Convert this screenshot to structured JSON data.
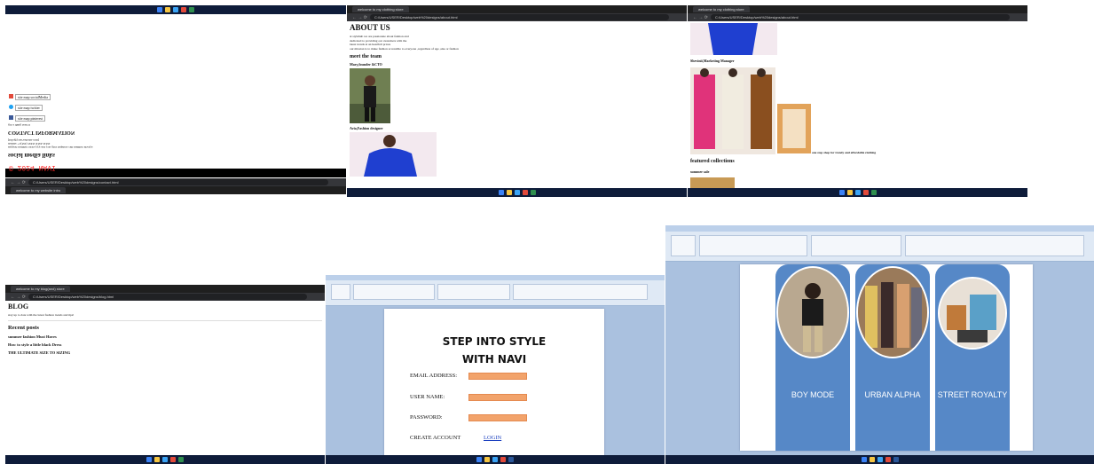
{
  "shot1": {
    "tab_title": "welcome to my website intro",
    "url": "C:/Users/USER/Desktop/web%20designs/contact.html",
    "socials": [
      "site map socialMedia",
      "site map twitter",
      "site map pinterest"
    ],
    "social_heading": "social media links",
    "contact_lines": [
      "support number xxxx-yyy-zzz you give inquires call number always",
      "mobile +1(XX) XXX XXX-XXX",
      "[info@yourwebsite.com]"
    ],
    "contact_heading": "CONTACT INFORMATION",
    "small_line": "got a thing read it",
    "footer_banner": "© 2024 NAVI"
  },
  "shot2": {
    "tab_title": "welcome to my clothing store",
    "url": "C:/Users/USER/Desktop/web%20designs/about.html",
    "heading": "ABOUT US",
    "intro": [
      "at stylehub we are passionate about fashion and",
      "dedicated to providing our customers with the",
      "latest trends at an heartfelt prices",
      "our mission is to make fashion accessible to everyone ,regardless of age ,size or fashion"
    ],
    "team_heading": "meet the team",
    "member1": "Mary,founder &CTO",
    "member2": "Avia,Fashion designer"
  },
  "shot3": {
    "tab_title": "welcome to my clothing store",
    "url": "C:/Users/USER/Desktop/web%20designs/about.html",
    "member3": "Shevinii,Marketing Manager",
    "tagline": "one stop shop for trendy and affordable clothing",
    "featured_heading": "featured collections",
    "summer_label": "summer sale"
  },
  "shot4": {
    "tab_title": "welcome to my blog(and) store",
    "url": "C:/Users/USER/Desktop/web%20designs/blog.html",
    "heading": "BLOG",
    "subline": "stay up to date with the latest fashion trends and tips!",
    "recent_heading": "Recent posts",
    "posts": [
      "summer fashion Must Haves",
      "How to style a little black Dress",
      "THE ULTIMATE SIZE TO SIZING"
    ]
  },
  "shot5": {
    "title_line1": "STEP INTO STYLE",
    "title_line2": "WITH NAVI",
    "fields": [
      "EMAIL ADDRESS:",
      "USER NAME:",
      "PASSWORD:"
    ],
    "create_label": "CREATE ACCOUNT",
    "login_label": "LOGIN"
  },
  "shot6": {
    "panels": [
      "BOY MODE",
      "URBAN ALPHA",
      "STREET ROYALTY"
    ]
  },
  "colors": {
    "taskbar": "#0e1c3a",
    "panel_blue": "#5688c7",
    "input_orange": "#f2a36b",
    "link_blue": "#1a3fbf",
    "banner_red": "#ff2a2a"
  }
}
